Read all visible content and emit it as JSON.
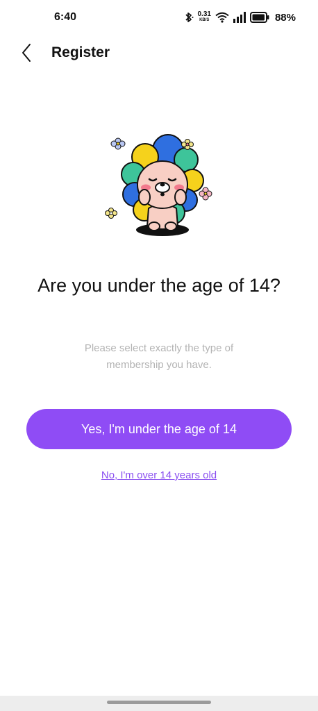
{
  "status_bar": {
    "time": "6:40",
    "net_speed_value": "0.31",
    "net_speed_unit": "KB/S",
    "battery": "88%",
    "icons": [
      "bluetooth-icon",
      "wifi-icon",
      "signal-icon",
      "battery-icon"
    ]
  },
  "header": {
    "back_icon": "chevron-left-icon",
    "title": "Register"
  },
  "content": {
    "illustration": "lion-character-icon",
    "question": "Are you under the age of 14?",
    "subtext": "Please select exactly the type of membership you have.",
    "primary_button": "Yes, I'm under the age of 14",
    "secondary_link": "No, I'm over 14 years old"
  },
  "colors": {
    "accent": "#8f4cf5",
    "link": "#8a4ff0",
    "subtext": "#b3b3b3"
  }
}
